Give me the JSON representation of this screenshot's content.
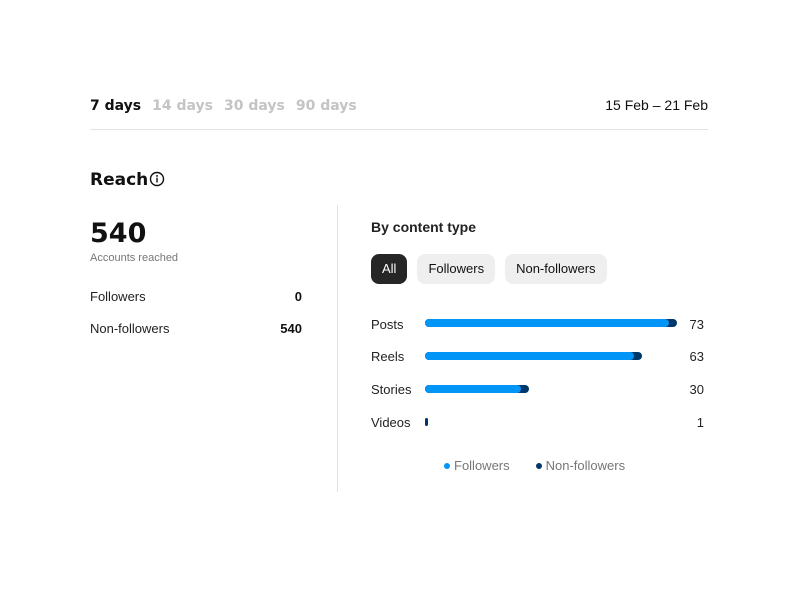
{
  "period_tabs": [
    {
      "label": "7 days",
      "active": true
    },
    {
      "label": "14 days",
      "active": false
    },
    {
      "label": "30 days",
      "active": false
    },
    {
      "label": "90 days",
      "active": false
    }
  ],
  "date_range": "15 Feb – 21 Feb",
  "reach": {
    "title": "Reach",
    "info_icon": "info-icon",
    "total": "540",
    "total_caption": "Accounts reached",
    "stats": [
      {
        "label": "Followers",
        "value": "0"
      },
      {
        "label": "Non-followers",
        "value": "540"
      }
    ]
  },
  "content_type": {
    "title": "By content type",
    "filters": [
      {
        "label": "All",
        "active": true
      },
      {
        "label": "Followers",
        "active": false
      },
      {
        "label": "Non-followers",
        "active": false
      }
    ],
    "rows": [
      {
        "label": "Posts",
        "value": 73
      },
      {
        "label": "Reels",
        "value": 63
      },
      {
        "label": "Stories",
        "value": 30
      },
      {
        "label": "Videos",
        "value": 1
      }
    ],
    "legend": [
      {
        "label": "Followers",
        "color": "#0095f6"
      },
      {
        "label": "Non-followers",
        "color": "#00376b"
      }
    ]
  },
  "colors": {
    "followers": "#0095f6",
    "non_followers": "#00376b",
    "accent_dark": "#262626"
  }
}
